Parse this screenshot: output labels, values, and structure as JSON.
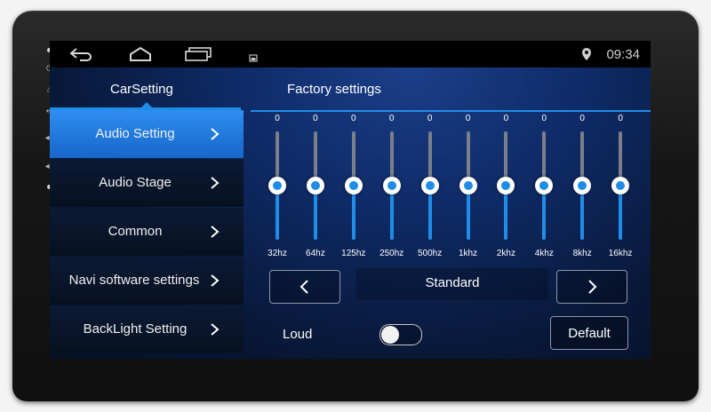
{
  "statusbar": {
    "time": "09:34",
    "icons": [
      "back-icon",
      "home-icon",
      "recent-apps-icon",
      "notification-icon",
      "location-icon"
    ]
  },
  "tabs": [
    {
      "label": "CarSetting",
      "active": true
    },
    {
      "label": "Factory settings",
      "active": false
    }
  ],
  "menu": {
    "items": [
      {
        "label": "Audio Setting",
        "active": true
      },
      {
        "label": "Audio Stage",
        "active": false
      },
      {
        "label": "Common",
        "active": false
      },
      {
        "label": "Navi software settings",
        "active": false
      },
      {
        "label": "BackLight Setting",
        "active": false
      }
    ]
  },
  "equalizer": {
    "bands": [
      {
        "label": "32hz",
        "value": "0",
        "level": 0.5
      },
      {
        "label": "64hz",
        "value": "0",
        "level": 0.5
      },
      {
        "label": "125hz",
        "value": "0",
        "level": 0.5
      },
      {
        "label": "250hz",
        "value": "0",
        "level": 0.5
      },
      {
        "label": "500hz",
        "value": "0",
        "level": 0.5
      },
      {
        "label": "1khz",
        "value": "0",
        "level": 0.5
      },
      {
        "label": "2khz",
        "value": "0",
        "level": 0.5
      },
      {
        "label": "4khz",
        "value": "0",
        "level": 0.5
      },
      {
        "label": "8khz",
        "value": "0",
        "level": 0.5
      },
      {
        "label": "16khz",
        "value": "0",
        "level": 0.5
      }
    ],
    "preset": "Standard"
  },
  "loud": {
    "label": "Loud",
    "on": false
  },
  "default_label": "Default",
  "colors": {
    "accent": "#1f8de8",
    "active_item": "#2a86ea",
    "background": "#0b1f4d"
  }
}
